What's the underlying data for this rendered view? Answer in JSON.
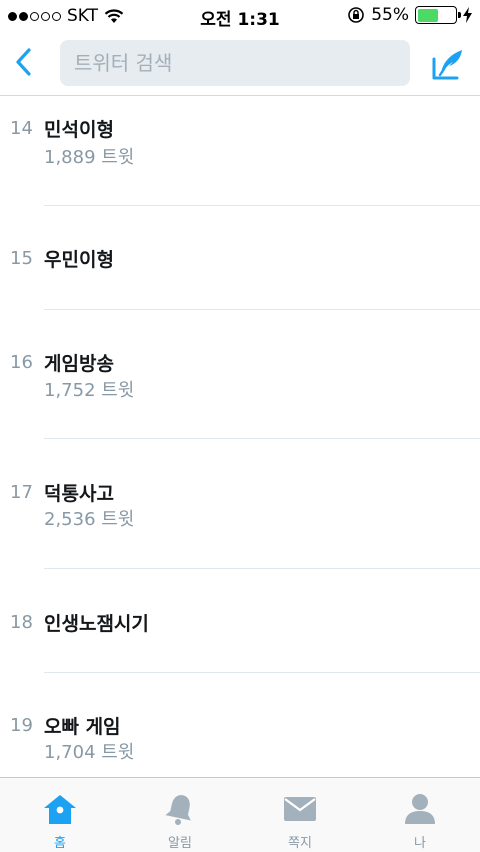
{
  "status_bar": {
    "carrier": "SKT",
    "time": "오전 1:31",
    "battery_percent": "55%",
    "battery_level": 0.55,
    "signal_bars_filled": 2,
    "signal_bars_total": 5
  },
  "nav": {
    "search_placeholder": "트위터 검색"
  },
  "trends": [
    {
      "rank": "14",
      "name": "민석이형",
      "count": "1,889 트윗"
    },
    {
      "rank": "15",
      "name": "우민이형",
      "count": ""
    },
    {
      "rank": "16",
      "name": "게임방송",
      "count": "1,752 트윗"
    },
    {
      "rank": "17",
      "name": "덕통사고",
      "count": "2,536 트윗"
    },
    {
      "rank": "18",
      "name": "인생노잼시기",
      "count": ""
    },
    {
      "rank": "19",
      "name": "오빠 게임",
      "count": "1,704 트윗"
    }
  ],
  "tabs": [
    {
      "label": "홈",
      "icon": "home-icon",
      "active": true
    },
    {
      "label": "알림",
      "icon": "bell-icon",
      "active": false
    },
    {
      "label": "쪽지",
      "icon": "envelope-icon",
      "active": false
    },
    {
      "label": "나",
      "icon": "profile-icon",
      "active": false
    }
  ],
  "colors": {
    "accent": "#1da1f2",
    "muted": "#8899a6",
    "tab_inactive": "#a3b1bc"
  }
}
